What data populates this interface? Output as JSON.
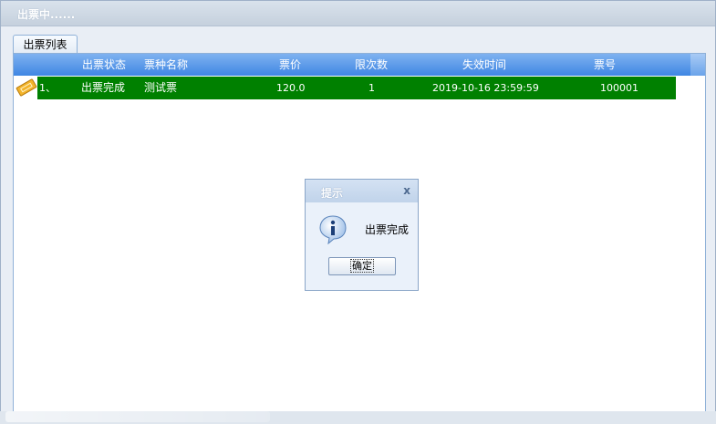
{
  "window": {
    "title": "出票中......"
  },
  "tab": {
    "label": "出票列表"
  },
  "grid": {
    "columns": [
      "出票状态",
      "票种名称",
      "票价",
      "限次数",
      "失效时间",
      "票号"
    ],
    "rows": [
      {
        "index": "1、",
        "status": "出票完成",
        "ticket_name": "测试票",
        "price": "120.0",
        "limit": "1",
        "expire": "2019-10-16 23:59:59",
        "ticket_no": "100001",
        "icon": "ticket-icon",
        "highlight_color": "#008000"
      }
    ]
  },
  "dialog": {
    "title": "提示",
    "close": "x",
    "message": "出票完成",
    "ok_label": "确定",
    "icon": "info-icon"
  },
  "colors": {
    "header_accent": "#3f86e3",
    "row_highlight": "#008000"
  }
}
